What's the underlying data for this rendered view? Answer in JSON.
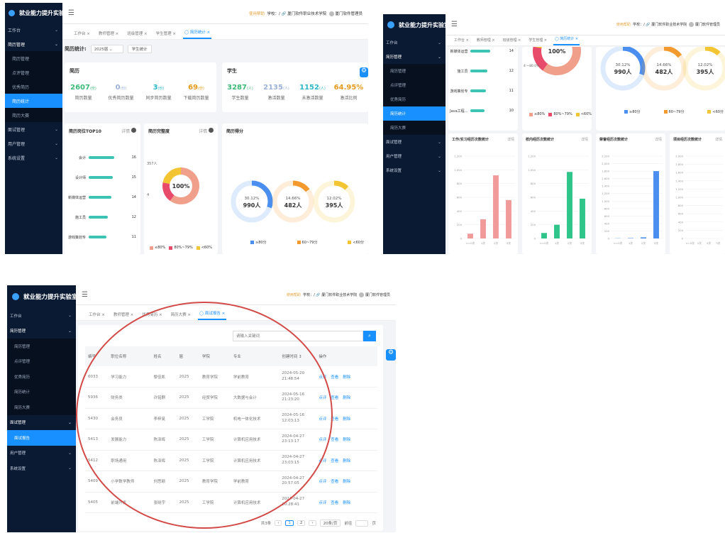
{
  "app": {
    "title": "就业能力提升实验室",
    "notice": "使用帮助",
    "school": "学校：/ 🔗 厦门软件职业技术学院",
    "user": "厦门软件管理员"
  },
  "menu": [
    {
      "label": "工作台",
      "icon": "dashboard-icon",
      "type": "top"
    },
    {
      "label": "简历管理",
      "icon": "resume-icon",
      "type": "group"
    },
    {
      "label": "简历管理",
      "type": "sub"
    },
    {
      "label": "点评管理",
      "type": "sub"
    },
    {
      "label": "优秀简历",
      "type": "sub"
    },
    {
      "label": "简历统计",
      "type": "sub"
    },
    {
      "label": "简历大赛",
      "type": "sub"
    },
    {
      "label": "面试管理",
      "icon": "interview-icon",
      "type": "top"
    },
    {
      "label": "用户管理",
      "icon": "user-icon",
      "type": "top"
    },
    {
      "label": "系统设置",
      "icon": "settings-icon",
      "type": "top"
    }
  ],
  "menu3": [
    {
      "label": "工作台",
      "type": "top"
    },
    {
      "label": "简历管理",
      "type": "group"
    },
    {
      "label": "简历管理",
      "type": "sub"
    },
    {
      "label": "点评管理",
      "type": "sub"
    },
    {
      "label": "优秀简历",
      "type": "sub"
    },
    {
      "label": "简历统计",
      "type": "sub"
    },
    {
      "label": "简历大赛",
      "type": "sub"
    },
    {
      "label": "面试管理",
      "type": "group"
    },
    {
      "label": "面试报告",
      "type": "sub"
    },
    {
      "label": "用户管理",
      "type": "top"
    },
    {
      "label": "系统设置",
      "type": "top"
    }
  ],
  "tabs1": [
    "工作台 ×",
    "教师管理 ×",
    "班级管理 ×",
    "学生管理 ×",
    "◯ 简历统计 ×"
  ],
  "tabs3": [
    "工作台 ×",
    "教师管理 ×",
    "优秀简历 ×",
    "简历大赛 ×",
    "◯ 面试报告 ×"
  ],
  "filter": {
    "title": "简历统计:",
    "year": "2025届",
    "button": "学生统计"
  },
  "resume": {
    "title": "简历",
    "stats": [
      {
        "num": "2607",
        "unit": "(份)",
        "label": "简历数量",
        "color": "#3cb878"
      },
      {
        "num": "0",
        "unit": "(份)",
        "label": "优秀简历数量",
        "color": "#9bb0d8"
      },
      {
        "num": "3",
        "unit": "(份)",
        "label": "同步简历数量",
        "color": "#2db7c8"
      },
      {
        "num": "69",
        "unit": "(份)",
        "label": "下载简历数量",
        "color": "#e69a1c"
      }
    ]
  },
  "student": {
    "title": "学生",
    "stats": [
      {
        "num": "3287",
        "unit": "(人)",
        "label": "学生数量",
        "color": "#3cb878"
      },
      {
        "num": "2135",
        "unit": "(人)",
        "label": "激活数量",
        "color": "#9bb0d8"
      },
      {
        "num": "1152",
        "unit": "(人)",
        "label": "未激活数量",
        "color": "#2db7c8"
      },
      {
        "num": "64.95%",
        "unit": "",
        "label": "激活比例",
        "color": "#e69a1c"
      }
    ]
  },
  "top10": {
    "title": "简历岗位TOP10",
    "more": "详情",
    "items": [
      {
        "label": "会计",
        "value": 16
      },
      {
        "label": "设计师",
        "value": 15
      },
      {
        "label": "新媒体运营",
        "value": 14
      },
      {
        "label": "施工员",
        "value": 12
      },
      {
        "label": "游戏策划专",
        "value": 11
      }
    ]
  },
  "completeness": {
    "title": "简历完整度",
    "more": "详情",
    "center": "100%",
    "labels": [
      "357人",
      "4"
    ],
    "legend": [
      {
        "label": "≤80%",
        "color": "#f0a08a"
      },
      {
        "label": "80%~79%",
        "color": "#e84a6a"
      },
      {
        "label": "<60%",
        "color": "#f3c532"
      }
    ]
  },
  "scores": {
    "title": "简历得分",
    "items": [
      {
        "pct": "30.12%",
        "count": "990人",
        "color": "#4a8ef0",
        "fill": 0.3012
      },
      {
        "pct": "14.66%",
        "count": "482人",
        "color": "#f39a2f",
        "fill": 0.1466
      },
      {
        "pct": "12.02%",
        "count": "395人",
        "color": "#f3c532",
        "fill": 0.1202
      }
    ],
    "legend": [
      "≥80分",
      "60~79分",
      "<60分"
    ]
  },
  "top10_b": {
    "items": [
      {
        "label": "新媒体运营",
        "value": 14
      },
      {
        "label": "施工员",
        "value": 12
      },
      {
        "label": "游戏策划专",
        "value": 11
      },
      {
        "label": "Java工程...",
        "value": 10
      }
    ]
  },
  "completeness_b": {
    "center": "100%",
    "labels": [
      "4 ~80.0%..."
    ],
    "legend": [
      "≤80%",
      "80%~79%",
      "<60%"
    ]
  },
  "chart_data": [
    {
      "type": "bar",
      "title": "工作/实习经历次数统计",
      "more": "详情",
      "categories": [
        "<=0次",
        "1次",
        "2次",
        "3次"
      ],
      "values": [
        70,
        280,
        920,
        560
      ],
      "ylim": [
        0,
        1200
      ],
      "yticks": [
        "0",
        "200",
        "400",
        "600",
        "800",
        "1,000",
        "1,200"
      ],
      "color": "#f09a9a"
    },
    {
      "type": "bar",
      "title": "校内经历次数统计",
      "more": "详情",
      "categories": [
        "<=0次",
        "1次",
        "2次",
        "3次"
      ],
      "values": [
        80,
        200,
        970,
        580
      ],
      "ylim": [
        0,
        1200
      ],
      "yticks": [
        "0",
        "200",
        "400",
        "600",
        "800",
        "1,000",
        "1,200"
      ],
      "color": "#2ec48a"
    },
    {
      "type": "bar",
      "title": "荣誉经历次数统计",
      "more": "详情",
      "categories": [
        "<=0次",
        "1次",
        "2次",
        "3次"
      ],
      "values": [
        5,
        10,
        30,
        1800
      ],
      "ylim": [
        0,
        2200
      ],
      "yticks": [
        "0",
        "200",
        "400",
        "600",
        "800",
        "1,000",
        "1,200",
        "1,400",
        "1,600",
        "1,800",
        "2,000",
        "2,200"
      ],
      "color": "#4a8ef0"
    },
    {
      "type": "bar",
      "title": "项目经历次数统计",
      "more": "详情",
      "categories": [
        "<=0次",
        "1次",
        "2次",
        "3次"
      ],
      "values": [
        0,
        0,
        0,
        0
      ],
      "ylim": [
        0,
        2000
      ],
      "yticks": [
        "0",
        "200",
        "400",
        "600",
        "800",
        "1,000",
        "1,200",
        "1,400",
        "1,600",
        "1,800",
        "2,000"
      ],
      "color": "#c0a0d8"
    }
  ],
  "report": {
    "search_placeholder": "请输入关键词",
    "columns": [
      "编号",
      "职位名称",
      "姓名",
      "届",
      "学院",
      "专业",
      "创建时间 ↕",
      "操作"
    ],
    "rows": [
      {
        "id": "6033",
        "job": "学习能力",
        "name": "黎佳凯",
        "year": "2025",
        "college": "教育学院",
        "major": "学前教育",
        "time": "2024-05-20 21:48:54"
      },
      {
        "id": "5936",
        "job": "财务类",
        "name": "许铭麒",
        "year": "2025",
        "college": "经贸学院",
        "major": "大数据与会计",
        "time": "2024-05-16 21:23:20"
      },
      {
        "id": "5430",
        "job": "会务员",
        "name": "李梓旻",
        "year": "2025",
        "college": "工学院",
        "major": "机电一体化技术",
        "time": "2024-05-16 12:03:13"
      },
      {
        "id": "5413",
        "job": "发展能力",
        "name": "陈泽辉",
        "year": "2025",
        "college": "工学院",
        "major": "计算机应用技术",
        "time": "2024-04-27 23:13:17"
      },
      {
        "id": "5412",
        "job": "职场通用",
        "name": "陈泽辉",
        "year": "2025",
        "college": "工学院",
        "major": "计算机应用技术",
        "time": "2024-04-27 23:03:15"
      },
      {
        "id": "5409",
        "job": "小学数学教师",
        "name": "刘思颖",
        "year": "2025",
        "college": "教育学院",
        "major": "学前教育",
        "time": "2024-04-27 20:57:05"
      },
      {
        "id": "5405",
        "job": "前端开发",
        "name": "张晓宇",
        "year": "2025",
        "college": "工学院",
        "major": "计算机应用技术",
        "time": "2024-04-27 20:28:41"
      }
    ],
    "ops": [
      "点评",
      "查看",
      "删除"
    ],
    "pager": {
      "total": "共3条",
      "pages": [
        "1",
        "2"
      ],
      "prev": "‹",
      "next": "›",
      "size": "20条/页",
      "goto": "前往",
      "page_unit": "页"
    }
  }
}
